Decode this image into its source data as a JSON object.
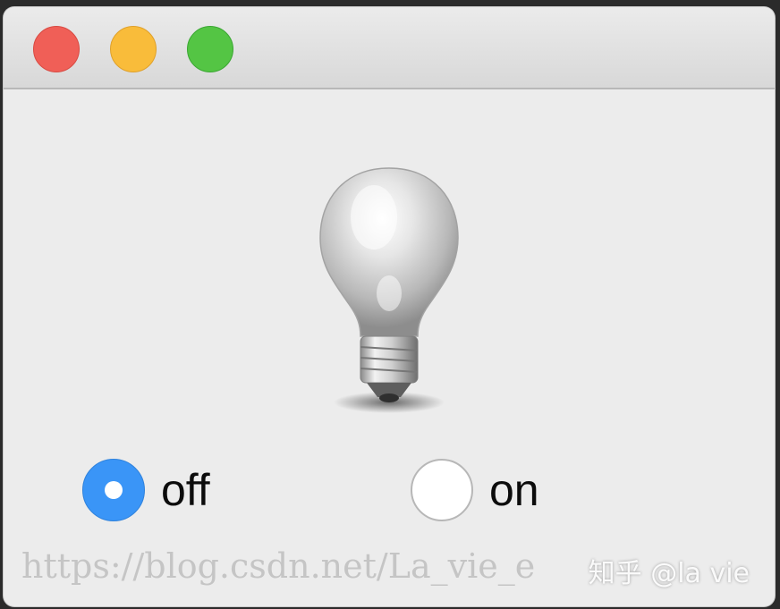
{
  "window": {
    "traffic_lights": {
      "close_color": "#f05f57",
      "minimize_color": "#f9bc3a",
      "maximize_color": "#54c544"
    }
  },
  "content": {
    "image": {
      "icon": "lightbulb-icon",
      "state": "off"
    },
    "radio_options": [
      {
        "label": "off",
        "checked": true
      },
      {
        "label": "on",
        "checked": false
      }
    ],
    "accent_color": "#3a95f7"
  },
  "watermarks": {
    "url": "https://blog.csdn.net/La_vie_e",
    "brand": "知乎 @la vie"
  }
}
